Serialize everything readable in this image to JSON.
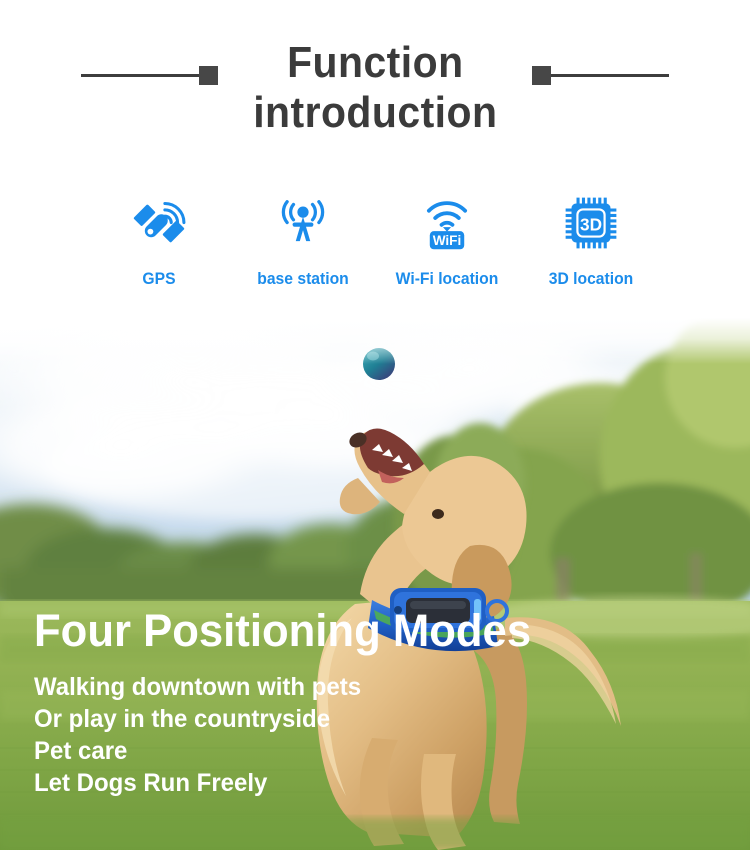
{
  "header": {
    "title_line1": "Function",
    "title_line2": "introduction",
    "ornament_left": "line-square-ornament",
    "ornament_right": "square-line-ornament",
    "title_color": "#3b3b3b"
  },
  "features": {
    "accent_color": "#1b8ceb",
    "items": [
      {
        "icon": "satellite-icon",
        "label": "GPS"
      },
      {
        "icon": "cell-tower-icon",
        "label": "base station"
      },
      {
        "icon": "wifi-badge-icon",
        "label": "Wi-Fi location"
      },
      {
        "icon": "chip-3d-icon",
        "label": "3D location",
        "badge_text": "3D"
      }
    ],
    "wifi_badge_text": "WiFi"
  },
  "photo": {
    "scene": "golden-retriever-wearing-blue-gps-collar-catching-ball-on-grass-lawn",
    "ball_color": "#2a7f91",
    "sky_color": "#cfe0ef",
    "grass_color": "#8fae4e",
    "collar_color": "#1f5fc4"
  },
  "overlay": {
    "headline": "Four Positioning Modes",
    "lines": [
      "Walking downtown with pets",
      "Or play in the countryside",
      "Pet care",
      "Let Dogs Run Freely"
    ],
    "text_color": "#ffffff"
  }
}
